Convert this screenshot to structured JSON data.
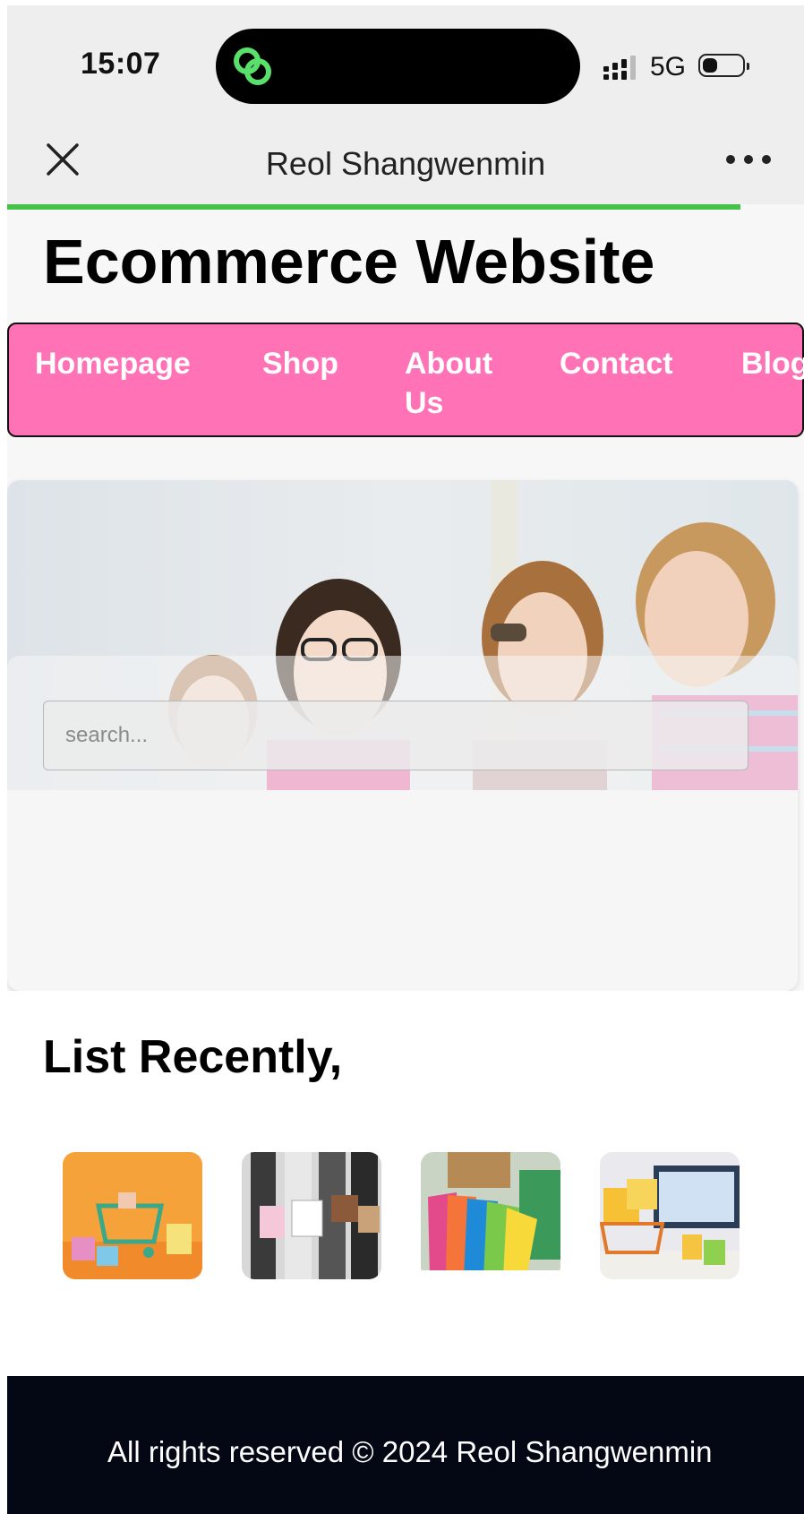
{
  "status_bar": {
    "time": "15:07",
    "network": "5G"
  },
  "nav": {
    "title": "Reol Shangwenmin",
    "progress": 0.92
  },
  "site": {
    "title": "Ecommerce Website"
  },
  "menu": {
    "items": [
      {
        "label": "Homepage"
      },
      {
        "label": "Shop"
      },
      {
        "label": "About Us"
      },
      {
        "label": "Contact"
      },
      {
        "label": "Blog"
      }
    ]
  },
  "search": {
    "placeholder": "search...",
    "value": ""
  },
  "recent": {
    "title": "List Recently,",
    "items": [
      {
        "image": "shopping-cart-gifts"
      },
      {
        "image": "shoppers-with-bags"
      },
      {
        "image": "colorful-shopping-bags"
      },
      {
        "image": "cart-with-boxes-laptop"
      }
    ]
  },
  "footer": {
    "text": "All rights reserved © 2024 Reol Shangwenmin"
  },
  "colors": {
    "menu_bg": "#ff72b6",
    "footer_bg": "#030814",
    "progress": "#45c24a"
  }
}
